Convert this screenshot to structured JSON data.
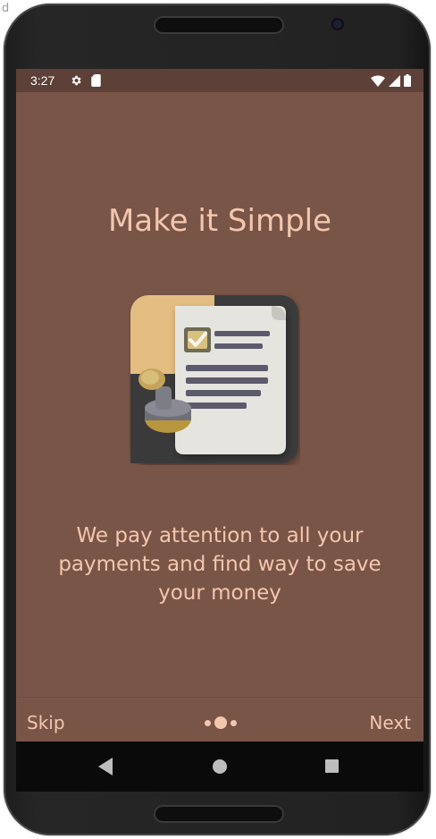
{
  "window_fragment": "d",
  "status_bar": {
    "time": "3:27",
    "icons": [
      "gear-icon",
      "sd-card-icon",
      "wifi-icon",
      "signal-icon",
      "battery-icon"
    ],
    "background": "#5d4037"
  },
  "onboarding": {
    "title": "Make it Simple",
    "illustration": "document-with-stamp-icon",
    "description": "We pay attention to all your payments and find way to save your money",
    "page_indicator": {
      "total": 3,
      "current": 2
    },
    "skip_label": "Skip",
    "next_label": "Next"
  },
  "navbar": {
    "icons": [
      "back-icon",
      "home-icon",
      "recent-apps-icon"
    ]
  },
  "colors": {
    "screen_background": "#795548",
    "accent_text": "#f4c6ae",
    "status_bar": "#5d4037",
    "nav_bar": "#0a0a0a"
  }
}
